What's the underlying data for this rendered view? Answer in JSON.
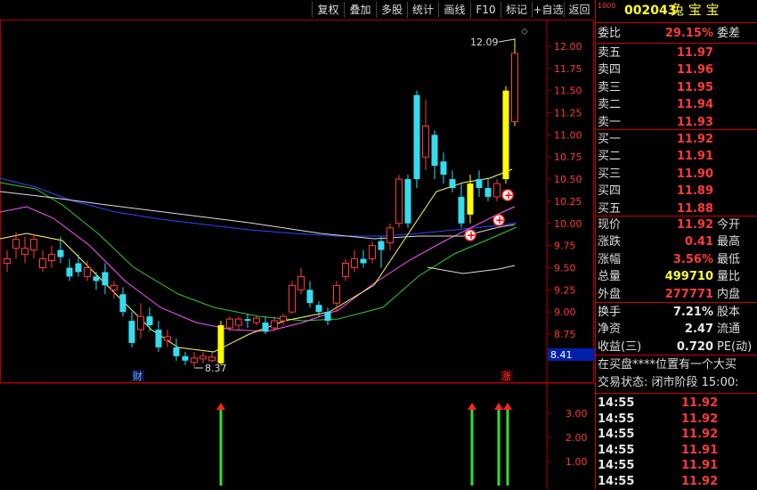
{
  "toolbar": {
    "buttons": [
      "复权",
      "叠加",
      "多股",
      "统计",
      "画线",
      "F10",
      "标记",
      "+自选",
      "返回"
    ]
  },
  "chart": {
    "price_axis": [
      "12.00",
      "11.75",
      "11.50",
      "11.25",
      "11.00",
      "10.75",
      "10.50",
      "10.25",
      "10.00",
      "9.75",
      "9.50",
      "9.25",
      "9.00",
      "8.75"
    ],
    "current_price_tag": "8.41",
    "high_label": "12.09",
    "low_label": "8.37",
    "marker_cai": "财",
    "marker_zhang": "涨",
    "indicator_axis": [
      "3.00",
      "2.00",
      "1.00"
    ]
  },
  "panel": {
    "stock_badge": "1000",
    "stock_code": "002043",
    "stock_name": "兔 宝 宝",
    "wei_bi_label": "委比",
    "wei_bi_value": "29.15%",
    "wei_cha_label": "委差",
    "asks": [
      {
        "label": "卖五",
        "price": "11.97"
      },
      {
        "label": "卖四",
        "price": "11.96"
      },
      {
        "label": "卖三",
        "price": "11.95"
      },
      {
        "label": "卖二",
        "price": "11.94"
      },
      {
        "label": "卖一",
        "price": "11.93"
      }
    ],
    "bids": [
      {
        "label": "买一",
        "price": "11.92"
      },
      {
        "label": "买二",
        "price": "11.91"
      },
      {
        "label": "买三",
        "price": "11.90"
      },
      {
        "label": "买四",
        "price": "11.89"
      },
      {
        "label": "买五",
        "price": "11.88"
      }
    ],
    "stats1": [
      {
        "label": "现价",
        "value": "11.92",
        "label2": "今开",
        "color": "red"
      },
      {
        "label": "涨跌",
        "value": "0.41",
        "label2": "最高",
        "color": "red"
      },
      {
        "label": "涨幅",
        "value": "3.56%",
        "label2": "最低",
        "color": "red"
      },
      {
        "label": "总量",
        "value": "499710",
        "label2": "量比",
        "color": "yellow"
      },
      {
        "label": "外盘",
        "value": "277771",
        "label2": "内盘",
        "color": "red"
      }
    ],
    "stats2": [
      {
        "label": "换手",
        "value": "7.21%",
        "label2": "股本",
        "color": "white"
      },
      {
        "label": "净资",
        "value": "2.47",
        "label2": "流通",
        "color": "white"
      },
      {
        "label": "收益(三)",
        "value": "0.720",
        "label2": "PE(动)",
        "color": "white"
      }
    ],
    "notice": "在买盘****位置有一个大买",
    "status": "交易状态: 闭市阶段 15:00:",
    "ticks": [
      {
        "time": "14:55",
        "price": "11.92"
      },
      {
        "time": "14:55",
        "price": "11.92"
      },
      {
        "time": "14:55",
        "price": "11.92"
      },
      {
        "time": "14:55",
        "price": "11.91"
      },
      {
        "time": "14:55",
        "price": "11.91"
      },
      {
        "time": "14:55",
        "price": "11.92"
      }
    ]
  }
}
